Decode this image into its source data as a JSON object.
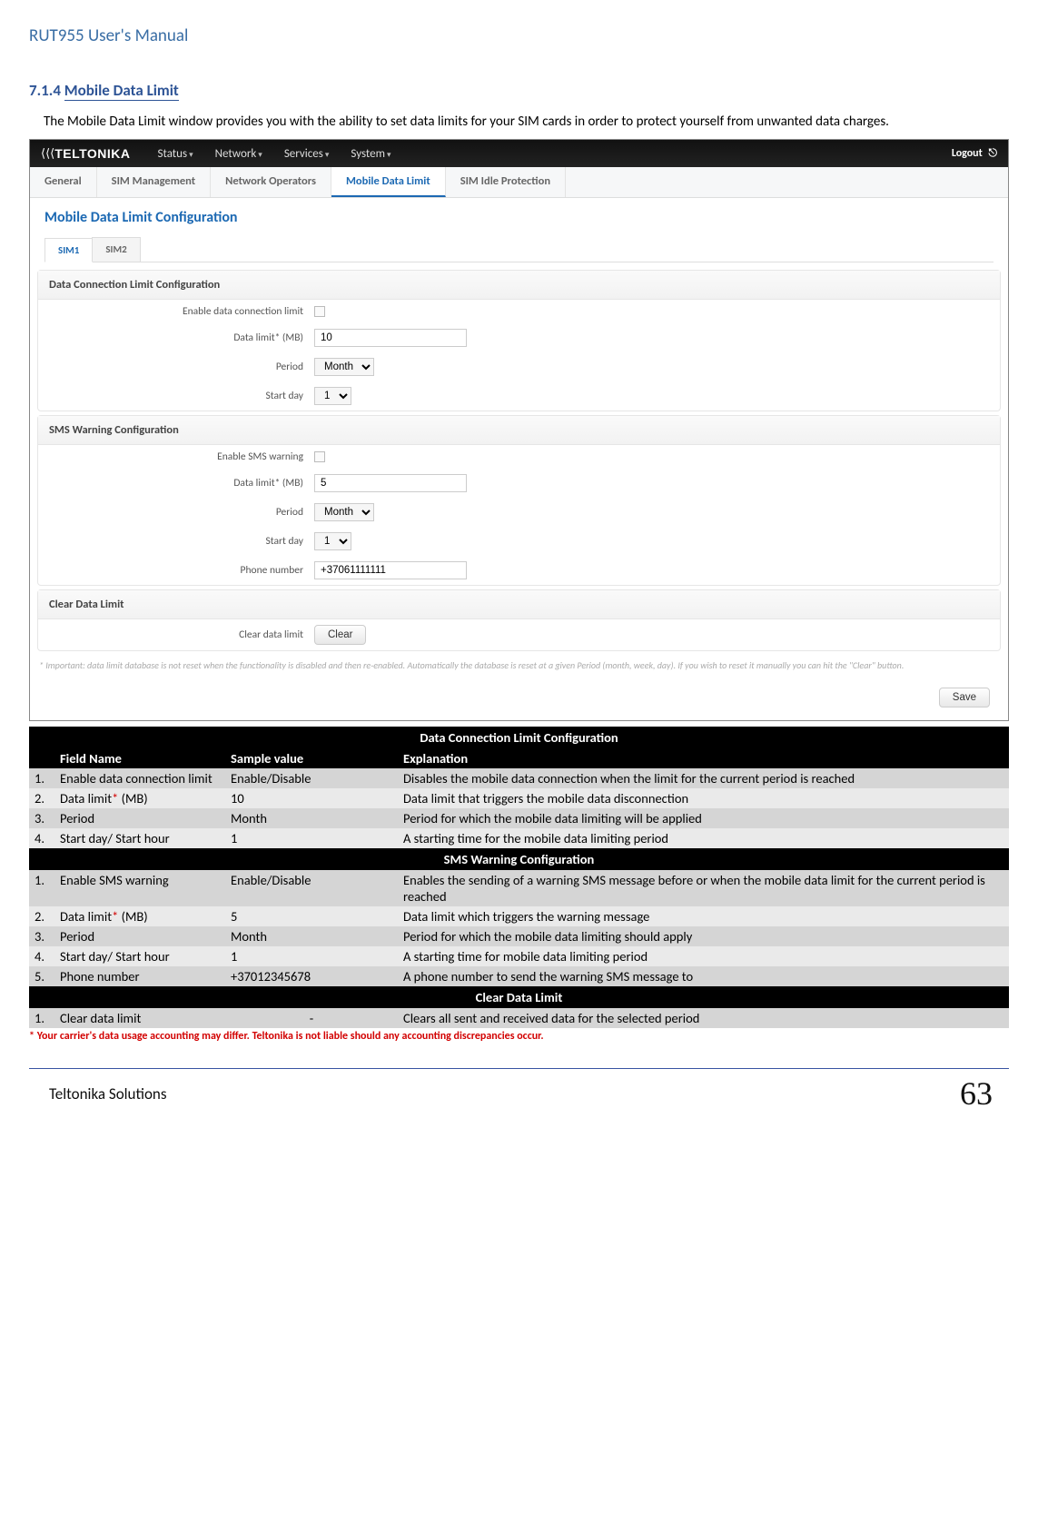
{
  "doc": {
    "header": "RUT955 User's Manual"
  },
  "section": {
    "number": "7.1.4 ",
    "title": "Mobile Data Limit",
    "intro": "The Mobile Data Limit window provides you with the ability to set data limits for your SIM cards in order to protect yourself from unwanted data charges."
  },
  "ui": {
    "brand": "TELTONIKA",
    "nav": [
      "Status",
      "Network",
      "Services",
      "System"
    ],
    "logout": "Logout",
    "subtabs": [
      "General",
      "SIM Management",
      "Network Operators",
      "Mobile Data Limit",
      "SIM Idle Protection"
    ],
    "page_title": "Mobile Data Limit Configuration",
    "simtabs": [
      "SIM1",
      "SIM2"
    ],
    "dcl": {
      "title": "Data Connection Limit Configuration",
      "enable_label": "Enable data connection limit",
      "limit_label": "Data limit* (MB)",
      "limit_value": "10",
      "period_label": "Period",
      "period_value": "Month",
      "startday_label": "Start day",
      "startday_value": "1"
    },
    "sms": {
      "title": "SMS Warning Configuration",
      "enable_label": "Enable SMS warning",
      "limit_label": "Data limit* (MB)",
      "limit_value": "5",
      "period_label": "Period",
      "period_value": "Month",
      "startday_label": "Start day",
      "startday_value": "1",
      "phone_label": "Phone number",
      "phone_value": "+37061111111"
    },
    "clear": {
      "title": "Clear Data Limit",
      "label": "Clear data limit",
      "button": "Clear"
    },
    "note": "* Important:  data limit database is not reset when the functionality is disabled and then re-enabled. Automatically the database is reset at a given Period (month, week, day). If you wish to reset it manually you can hit the \"Clear\" button.",
    "save": "Save"
  },
  "table": {
    "sections": [
      "Data Connection Limit Configuration",
      "SMS Warning Configuration",
      "Clear Data Limit"
    ],
    "headers": [
      "Field Name",
      "Sample value",
      "Explanation"
    ],
    "dcl": [
      {
        "n": "1.",
        "f": "Enable data connection limit",
        "s": "Enable/Disable",
        "e": "Disables  the  mobile  data  connection  when  the  limit  for  the current period is reached"
      },
      {
        "n": "2.",
        "f1": "Data limit",
        "star": "*",
        "f2": " (MB)",
        "s": "10",
        "e": "Data limit that triggers the mobile data disconnection"
      },
      {
        "n": "3.",
        "f": "Period",
        "s": "Month",
        "e": "Period for which the mobile data limiting will be applied"
      },
      {
        "n": "4.",
        "f": "Start day/ Start hour",
        "s": "1",
        "e": "A starting time for the mobile data limiting period"
      }
    ],
    "sms": [
      {
        "n": "1.",
        "f": "Enable SMS warning",
        "s": "Enable/Disable",
        "e": "Enables the sending of a warning SMS message before or when the mobile data limit for the current period is reached"
      },
      {
        "n": "2.",
        "f1": "Data limit",
        "star": "*",
        "f2": " (MB)",
        "s": "5",
        "e": "Data limit which triggers the warning message"
      },
      {
        "n": "3.",
        "f": "Period",
        "s": "Month",
        "e": "Period for which the mobile data limiting should apply"
      },
      {
        "n": "4.",
        "f": "Start day/ Start hour",
        "s": "1",
        "e": "A starting time for mobile data limiting period"
      },
      {
        "n": "5.",
        "f": "Phone number",
        "s": "+37012345678",
        "e": "A phone number to send the warning SMS message to"
      }
    ],
    "clr": [
      {
        "n": "1.",
        "f": "Clear data limit",
        "s": "-",
        "e": "Clears all sent and received data for the selected period"
      }
    ]
  },
  "disclaimer": "* Your carrier's data usage accounting may differ. Teltonika is not liable should any accounting discrepancies occur.",
  "footer": {
    "left": "Teltonika Solutions",
    "page": "63"
  }
}
